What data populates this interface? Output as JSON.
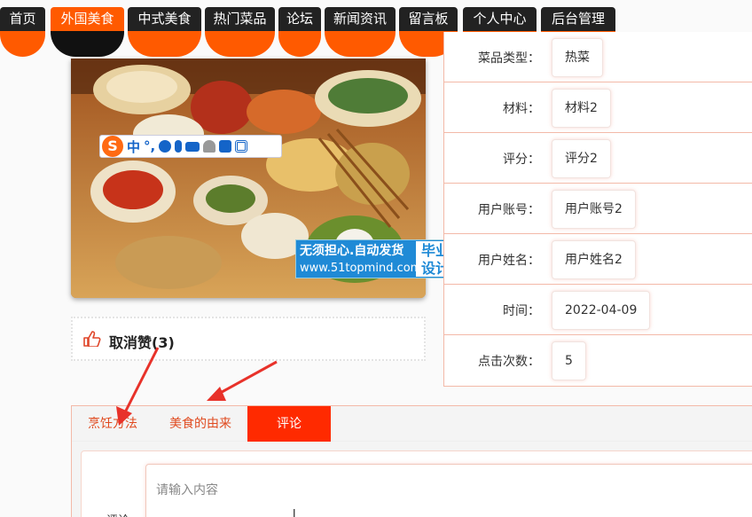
{
  "nav": {
    "items": [
      {
        "label": "首页",
        "active": false
      },
      {
        "label": "外国美食",
        "active": true
      },
      {
        "label": "中式美食",
        "active": false
      },
      {
        "label": "热门菜品",
        "active": false
      },
      {
        "label": "论坛",
        "active": false
      },
      {
        "label": "新闻资讯",
        "active": false
      },
      {
        "label": "留言板",
        "active": false
      },
      {
        "label": "个人中心",
        "active": false
      },
      {
        "label": "后台管理",
        "active": false
      }
    ]
  },
  "ime": {
    "mode": "中",
    "punct": "°,"
  },
  "banner": {
    "line1": "无须担心.自动发货",
    "line2": "www.51topmind.com",
    "badge1": "毕业",
    "badge2": "设计"
  },
  "like": {
    "label": "取消赞(3)"
  },
  "info": {
    "rows": [
      {
        "key": "菜品类型：",
        "value": "热菜"
      },
      {
        "key": "材料：",
        "value": "材料2"
      },
      {
        "key": "评分：",
        "value": "评分2"
      },
      {
        "key": "用户账号：",
        "value": "用户账号2"
      },
      {
        "key": "用户姓名：",
        "value": "用户姓名2"
      },
      {
        "key": "时间：",
        "value": "2022-04-09"
      },
      {
        "key": "点击次数：",
        "value": "5"
      }
    ]
  },
  "tabs": {
    "items": [
      {
        "label": "烹饪方法",
        "active": false
      },
      {
        "label": "美食的由来",
        "active": false
      },
      {
        "label": "评论",
        "active": true
      }
    ]
  },
  "comment": {
    "placeholder": "请输入内容",
    "label": "评论"
  },
  "colors": {
    "accent": "#ff5a00",
    "tab_active": "#ff2a00",
    "annotation": "#e8322a"
  }
}
